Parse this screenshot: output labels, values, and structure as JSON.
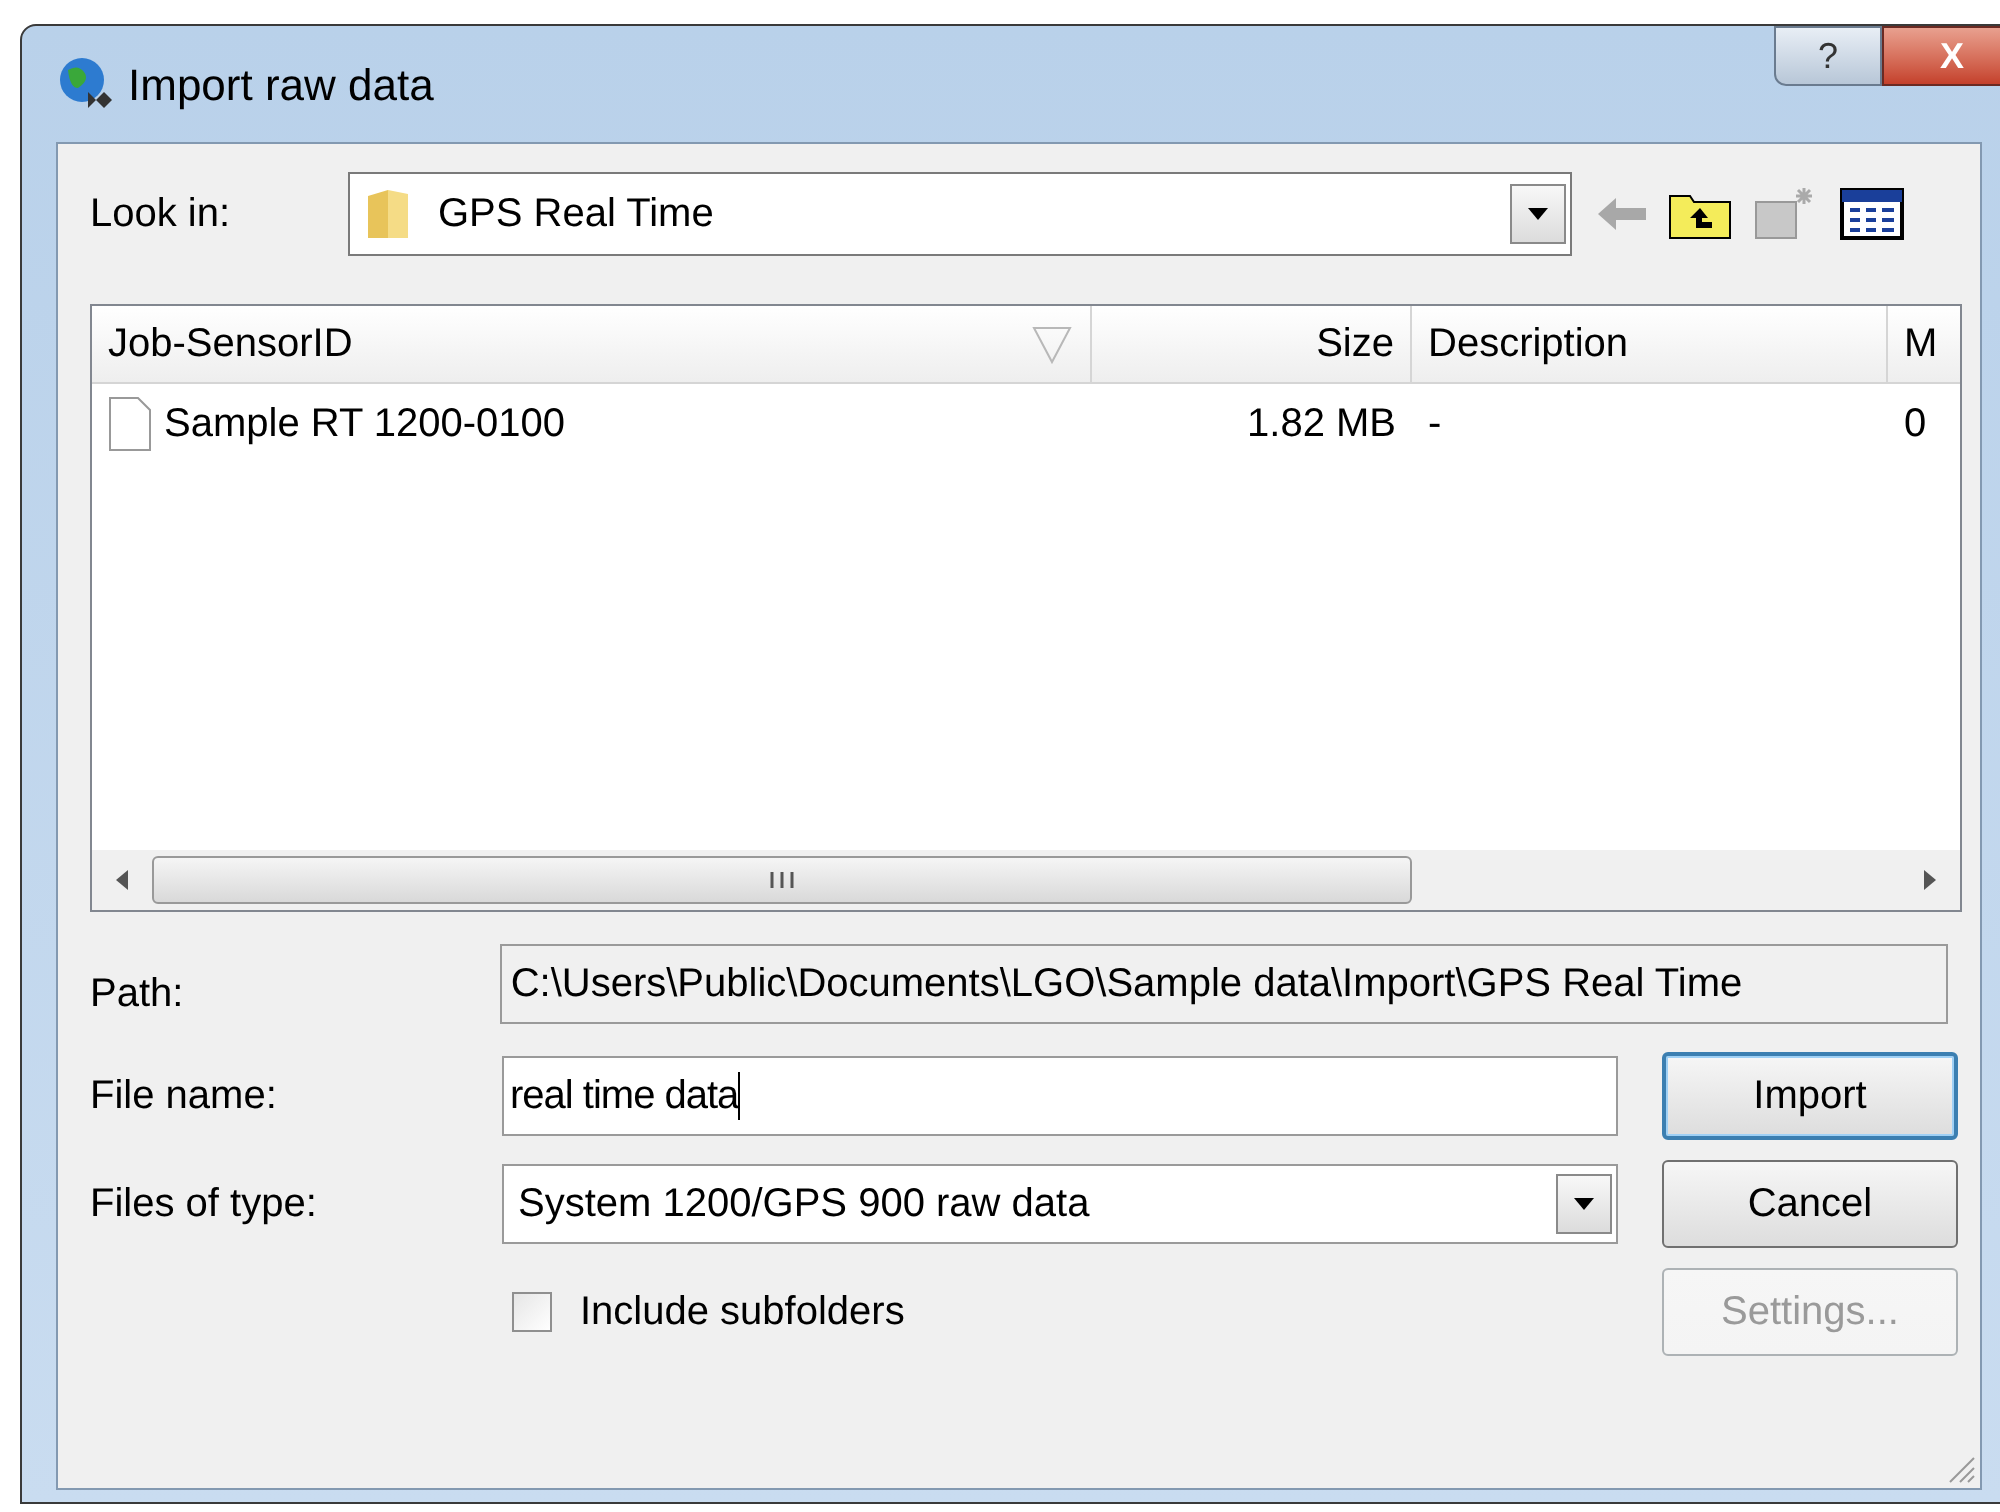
{
  "window": {
    "title": "Import raw data",
    "help": "?",
    "close": "X"
  },
  "look_in": {
    "label": "Look in:",
    "value": "GPS Real Time"
  },
  "file_list": {
    "columns": [
      {
        "label": "Job-SensorID",
        "sorted": true
      },
      {
        "label": "Size",
        "sorted": false
      },
      {
        "label": "Description",
        "sorted": false
      },
      {
        "label": "M",
        "sorted": false
      }
    ],
    "rows": [
      {
        "selected": false,
        "cells": [
          "Sample RT 1200-0100",
          "1.82 MB",
          "-",
          "0"
        ]
      }
    ]
  },
  "path": {
    "label": "Path:",
    "value": "C:\\Users\\Public\\Documents\\LGO\\Sample data\\Import\\GPS Real Time"
  },
  "file_name": {
    "label": "File name:",
    "value": "real time data"
  },
  "file_type": {
    "label": "Files of type:",
    "value": "System 1200/GPS 900 raw data"
  },
  "include_subfolders": {
    "label": "Include subfolders",
    "checked": false
  },
  "buttons": [
    {
      "label": "Import",
      "disabled": false,
      "default": true
    },
    {
      "label": "Cancel",
      "disabled": false,
      "default": false
    },
    {
      "label": "Settings...",
      "disabled": true,
      "default": false
    }
  ]
}
